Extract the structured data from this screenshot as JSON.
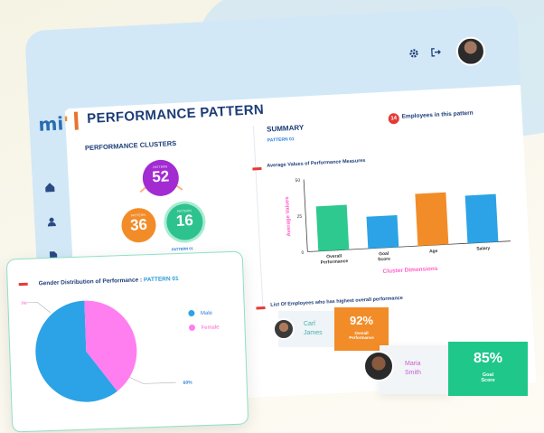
{
  "app": {
    "logo_text": "mi",
    "page_title": "PERFORMANCE PATTERN"
  },
  "topbar": {
    "icons": [
      "gear-icon",
      "logout-icon"
    ],
    "avatar": "user-avatar"
  },
  "sidebar": {
    "icons": [
      "home-icon",
      "user-icon",
      "document-icon"
    ]
  },
  "clusters": {
    "title": "PERFORMANCE CLUSTERS",
    "top": {
      "label": "PATTERN",
      "value": "52",
      "color": "#a22bd2"
    },
    "left": {
      "label": "PATTERN",
      "value": "36",
      "color": "#f28c28"
    },
    "right": {
      "label": "PATTERN",
      "value": "16",
      "color": "#2ec28f"
    },
    "selected_label": "PATTERN 01"
  },
  "summary": {
    "title": "SUMMARY",
    "pattern": "PATTERN 01",
    "count": "14",
    "count_label": "Employees in this pattern"
  },
  "bar_chart_title": "Average Values of Performance Measures",
  "list_title": "List Of Employees who has highest overall performance",
  "chart_data": [
    {
      "type": "bar",
      "title": "Average Values of Performance Measures",
      "categories": [
        "Overall Performance",
        "Goal Score",
        "Age",
        "Salary"
      ],
      "values": [
        31,
        22,
        36,
        33
      ],
      "colors": [
        "#2ec98f",
        "#2ba3e6",
        "#f28c28",
        "#2ba3e6"
      ],
      "xlabel": "Cluster Dimensions",
      "ylabel": "Average Values",
      "yticks": [
        "0",
        "25",
        "50"
      ],
      "ylim": [
        0,
        50
      ]
    },
    {
      "type": "pie",
      "title": "Gender Distribution of Performance : PATTERN 01",
      "slices": [
        {
          "name": "Male",
          "value": 60,
          "label": "60%",
          "color": "#2ba3e6"
        },
        {
          "name": "Female",
          "value": 40,
          "label": "40%",
          "color": "#ff7ef0"
        }
      ]
    }
  ],
  "pie": {
    "title_main": "Gender Distribution of Performance : ",
    "title_pattern": "PATTERN 01",
    "legend_male": "Male",
    "legend_female": "Female",
    "label_male": "60%",
    "label_female": "40%"
  },
  "employees": [
    {
      "first": "Carl",
      "last": "James",
      "stat_value": "92%",
      "stat_label_1": "Overall",
      "stat_label_2": "Performance",
      "color": "#f28c28"
    },
    {
      "first": "Maria",
      "last": "Smith",
      "stat_value": "85%",
      "stat_label_1": "Goal",
      "stat_label_2": "Score",
      "color": "#1fc78a"
    }
  ]
}
